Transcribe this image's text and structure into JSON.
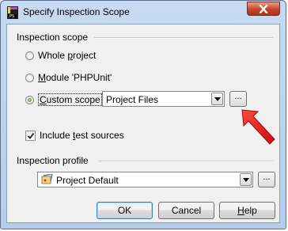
{
  "window": {
    "title": "Specify Inspection Scope",
    "app_icon": "phpstorm-icon",
    "close_icon": "close-icon"
  },
  "scope": {
    "section_label": "Inspection scope",
    "options": [
      {
        "pre": "Whole ",
        "key": "p",
        "post": "roject",
        "selected": false
      },
      {
        "pre": "",
        "key": "M",
        "post": "odule 'PHPUnit'",
        "selected": false
      },
      {
        "pre": "",
        "key": "C",
        "post": "ustom scope",
        "selected": true
      }
    ],
    "custom_scope_value": "Project Files",
    "browse_label": "...",
    "include_tests": {
      "pre": "Include ",
      "key": "t",
      "post": "est sources",
      "checked": true
    }
  },
  "profile": {
    "section_label": "Inspection profile",
    "value": "Project Default",
    "browse_label": "...",
    "icon": "inspection-profile-icon"
  },
  "buttons": {
    "ok": "OK",
    "cancel": "Cancel",
    "help": {
      "key": "H",
      "post": "elp"
    }
  },
  "annotation": {
    "arrow_color": "#e8161b",
    "icon": "red-arrow-icon"
  }
}
